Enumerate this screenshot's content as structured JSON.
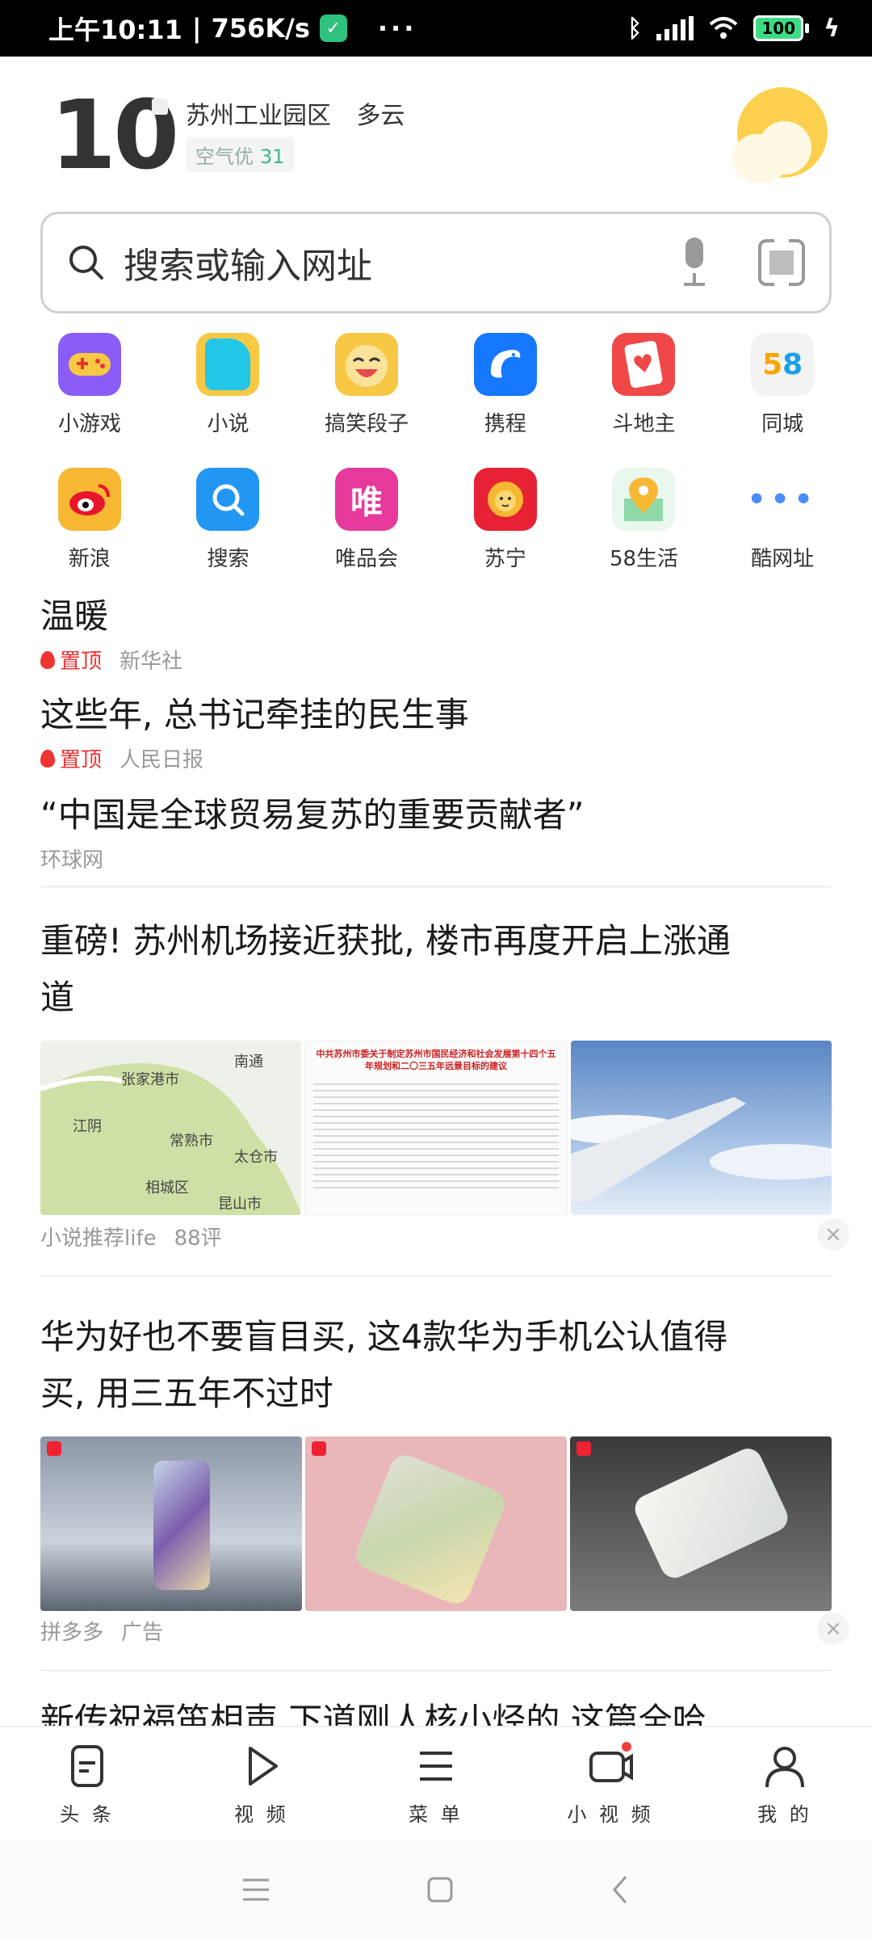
{
  "status_bar": {
    "time": "上午10:11",
    "speed": "756K/s",
    "dots": "···",
    "battery": "100"
  },
  "weather": {
    "temperature": "10",
    "location": "苏州工业园区",
    "condition": "多云",
    "air_label": "空气优",
    "air_value": "31",
    "icon": "partly-cloudy-icon"
  },
  "search": {
    "placeholder": "搜索或输入网址"
  },
  "shortcuts": [
    {
      "label": "小游戏",
      "icon": "gamepad-icon",
      "color": "#8b5cf6"
    },
    {
      "label": "小说",
      "icon": "book-icon",
      "color": "#22c7e8"
    },
    {
      "label": "搞笑段子",
      "icon": "laughing-face-icon",
      "color": "#f7c843"
    },
    {
      "label": "携程",
      "icon": "dolphin-icon",
      "color": "#1677ff"
    },
    {
      "label": "斗地主",
      "icon": "playing-card-icon",
      "color": "#f04848"
    },
    {
      "label": "同城",
      "icon": "58-icon",
      "color": "#f3f3f3"
    },
    {
      "label": "新浪",
      "icon": "sina-eye-icon",
      "color": "#f7b733"
    },
    {
      "label": "搜索",
      "icon": "magnifier-icon",
      "color": "#2196f3"
    },
    {
      "label": "唯品会",
      "icon": "vip-icon",
      "color": "#e6399b"
    },
    {
      "label": "苏宁",
      "icon": "lion-icon",
      "color": "#e62234"
    },
    {
      "label": "58生活",
      "icon": "map-pin-icon",
      "color": "#3cc47a"
    },
    {
      "label": "酷网址",
      "icon": "more-dots-icon",
      "color": "#ffffff"
    }
  ],
  "feed": {
    "pinned": [
      {
        "title": "温暖",
        "tag": "置顶",
        "source": "新华社"
      },
      {
        "title": "这些年, 总书记牵挂的民生事",
        "tag": "置顶",
        "source": "人民日报"
      },
      {
        "title": "“中国是全球贸易复苏的重要贡献者”",
        "tag": "",
        "source": "环球网"
      }
    ],
    "article1": {
      "title_line1": "重磅! 苏州机场接近获批, 楼市再度开启上涨通",
      "title_line2": "道",
      "source": "小说推荐life",
      "comments": "88评",
      "map_labels": [
        "张家港市",
        "常熟市",
        "太仓市",
        "相城区",
        "昆山市",
        "南通",
        "江阴"
      ],
      "doc_title": "中共苏州市委关于制定苏州市国民经济和社会发展第十四个五年规划和二〇三五年远景目标的建议"
    },
    "article2": {
      "title_line1": "华为好也不要盲目买, 这4款华为手机公认值得",
      "title_line2": "买, 用三五年不过时",
      "source": "拼多多",
      "ad": "广告"
    },
    "article3_partial": "新传祝福笛相声 下道刚人核小烃的 这篇全哈"
  },
  "bottom_nav": [
    {
      "label": "头 条",
      "icon": "headline-icon"
    },
    {
      "label": "视 频",
      "icon": "play-icon"
    },
    {
      "label": "菜 单",
      "icon": "menu-icon"
    },
    {
      "label": "小 视 频",
      "icon": "camera-icon"
    },
    {
      "label": "我 的",
      "icon": "person-icon"
    }
  ],
  "system_nav": {
    "menu": "≡",
    "home": "□",
    "back": "‹"
  }
}
